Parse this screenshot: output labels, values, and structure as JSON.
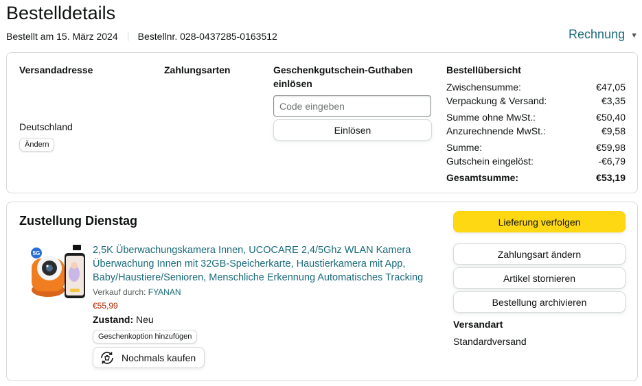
{
  "page": {
    "title": "Bestelldetails",
    "order_date": "Bestellt am 15. März 2024",
    "order_number": "Bestellnr. 028-0437285-0163512",
    "invoice_label": "Rechnung"
  },
  "address": {
    "heading": "Versandadresse",
    "country": "Deutschland",
    "change_label": "Ändern"
  },
  "payment": {
    "heading": "Zahlungsarten"
  },
  "gift_card": {
    "heading": "Geschenkgutschein-Guthaben einlösen",
    "placeholder": "Code eingeben",
    "redeem_label": "Einlösen"
  },
  "summary": {
    "heading": "Bestellübersicht",
    "rows": [
      {
        "label": "Zwischensumme:",
        "value": "€47,05"
      },
      {
        "label": "Verpackung & Versand:",
        "value": "€3,35"
      },
      {
        "label": "Summe ohne MwSt.:",
        "value": "€50,40"
      },
      {
        "label": "Anzurechnende MwSt.:",
        "value": "€9,58"
      },
      {
        "label": "Summe:",
        "value": "€59,98"
      },
      {
        "label": "Gutschein eingelöst:",
        "value": "-€6,79"
      },
      {
        "label": "Gesamtsumme:",
        "value": "€53,19"
      }
    ]
  },
  "shipment": {
    "title": "Zustellung Dienstag",
    "product_title": "2,5K Überwachungskamera Innen, UCOCARE 2,4/5Ghz WLAN Kamera Überwachung Innen mit 32GB-Speicherkarte, Haustierkamera mit App, Baby/Haustiere/Senioren, Menschliche Erkennung Automatisches Tracking",
    "seller_prefix": "Verkauf durch:",
    "seller": "FYANAN",
    "price": "€55,99",
    "condition_label": "Zustand:",
    "condition": "Neu",
    "gift_option_label": "Geschenkoption hinzufügen",
    "buy_again_label": "Nochmals kaufen",
    "buttons": {
      "track": "Lieferung verfolgen",
      "change_payment": "Zahlungsart ändern",
      "cancel": "Artikel stornieren",
      "archive": "Bestellung archivieren"
    },
    "shipping_method_heading": "Versandart",
    "shipping_method": "Standardversand"
  },
  "colors": {
    "link": "#1a6a7a",
    "price": "#b12704",
    "primary_button": "#ffd814",
    "camera_orange": "#f07d1f"
  }
}
